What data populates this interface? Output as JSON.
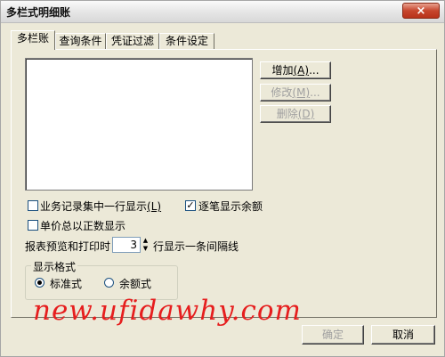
{
  "window": {
    "title": "多栏式明细账",
    "close_glyph": "×"
  },
  "tabs": [
    {
      "label": "多栏账",
      "active": true
    },
    {
      "label": "查询条件",
      "active": false
    },
    {
      "label": "凭证过滤",
      "active": false
    },
    {
      "label": "条件设定",
      "active": false
    }
  ],
  "list": {
    "items": []
  },
  "buttons": {
    "add": {
      "text": "增加",
      "mnemonic": "(A)",
      "ellipsis": "...",
      "enabled": true
    },
    "edit": {
      "text": "修改",
      "mnemonic": "(M)",
      "ellipsis": "...",
      "enabled": false
    },
    "delete": {
      "text": "删除",
      "mnemonic": "(D)",
      "enabled": false
    },
    "ok": {
      "label": "确定",
      "enabled": false
    },
    "cancel": {
      "label": "取消",
      "enabled": true
    }
  },
  "options": {
    "single_line": {
      "label": "业务记录集中一行显示",
      "mnemonic": "(L)",
      "checked": false
    },
    "show_balance": {
      "label": "逐笔显示余额",
      "checked": true
    },
    "positive_price": {
      "label": "单价总以正数显示",
      "checked": false
    }
  },
  "separator": {
    "prefix": "报表预览和打印时",
    "value": "3",
    "suffix": "行显示一条间隔线"
  },
  "display_format": {
    "title": "显示格式",
    "options": [
      {
        "label": "标准式",
        "selected": true
      },
      {
        "label": "余额式",
        "selected": false
      }
    ]
  },
  "watermark": "new.ufidawhy.com",
  "icons": {
    "check": "✓",
    "spin_up": "▲",
    "spin_down": "▼"
  }
}
